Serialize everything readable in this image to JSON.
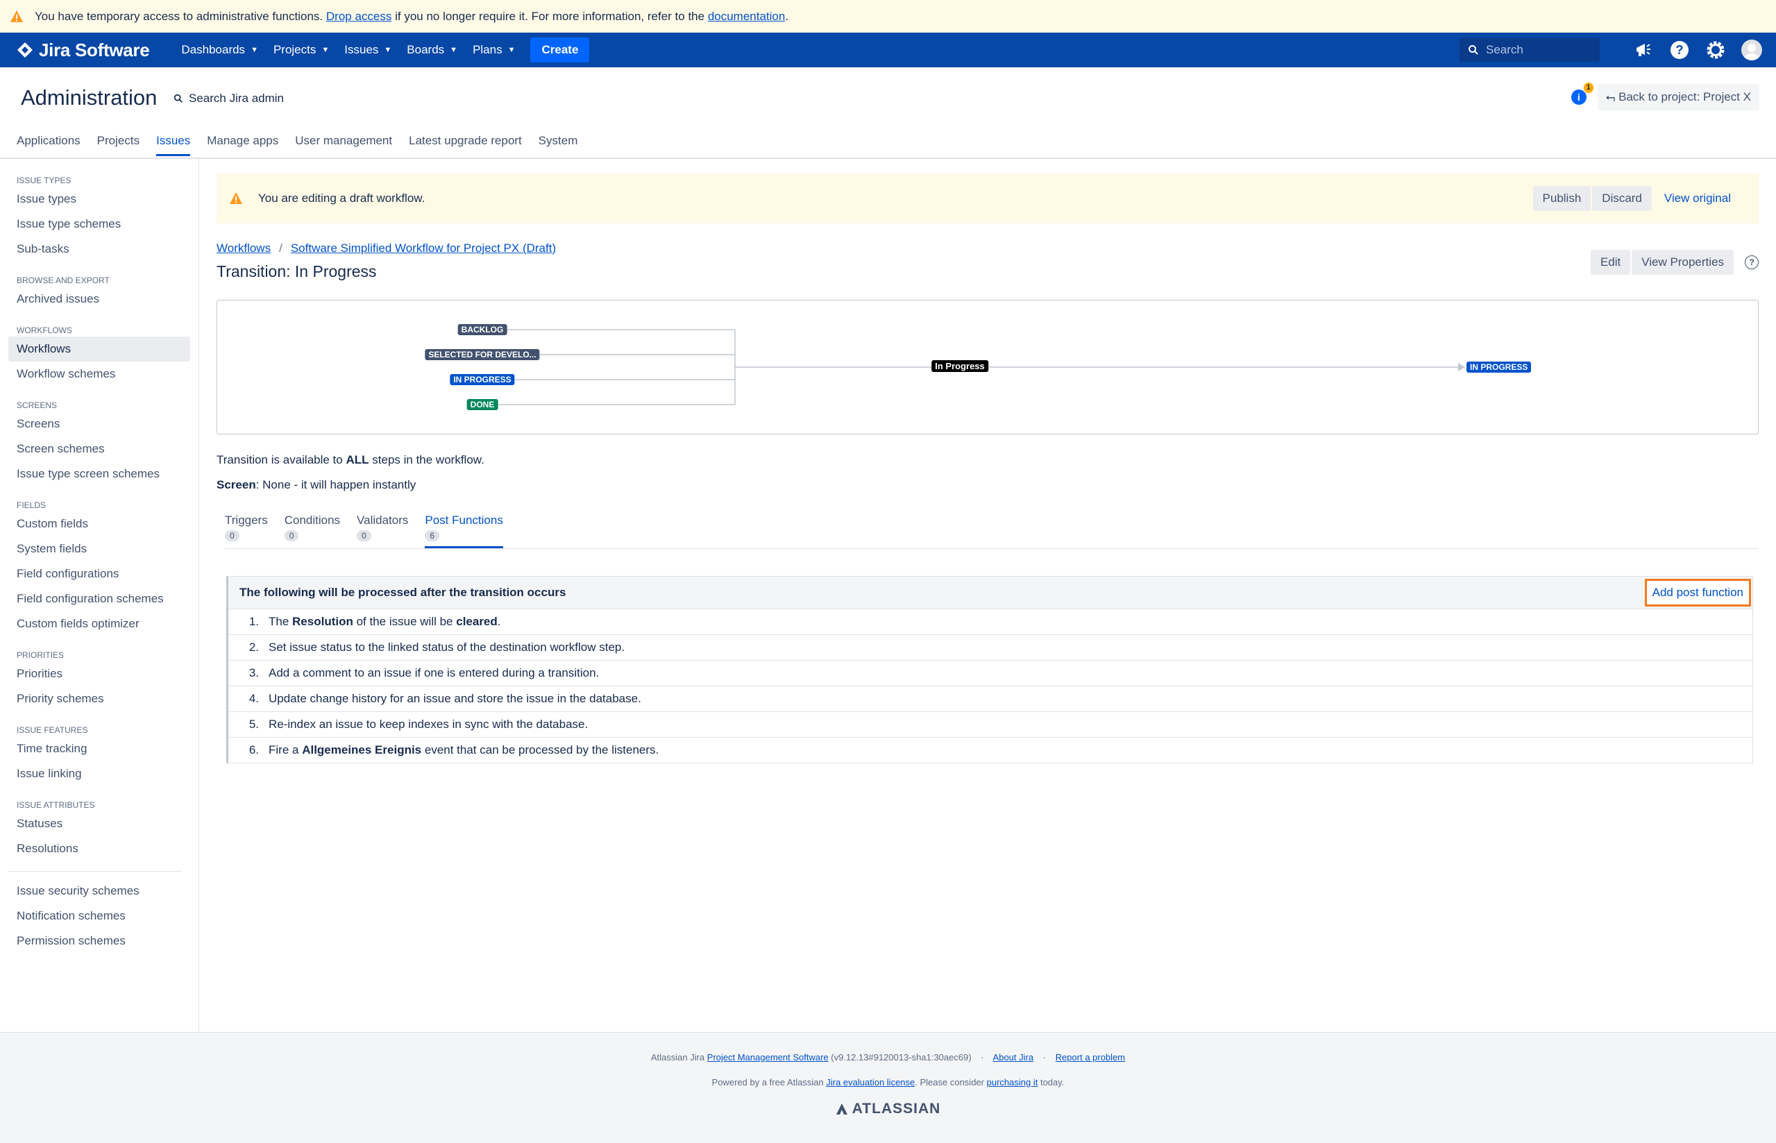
{
  "banner": {
    "text_before": "You have temporary access to administrative functions.",
    "drop_link": "Drop access",
    "text_middle": "if you no longer require it. For more information, refer to the",
    "doc_link": "documentation",
    "text_after": "."
  },
  "nav": {
    "brand": "Jira Software",
    "items": [
      "Dashboards",
      "Projects",
      "Issues",
      "Boards",
      "Plans"
    ],
    "create_label": "Create",
    "search_placeholder": "Search"
  },
  "admin": {
    "title": "Administration",
    "search_placeholder": "Search Jira admin",
    "notification_count": "1",
    "back_label": "Back to project: Project X",
    "tabs": [
      "Applications",
      "Projects",
      "Issues",
      "Manage apps",
      "User management",
      "Latest upgrade report",
      "System"
    ],
    "active_tab": "Issues"
  },
  "sidebar": {
    "groups": [
      {
        "heading": "Issue types",
        "items": [
          "Issue types",
          "Issue type schemes",
          "Sub-tasks"
        ]
      },
      {
        "heading": "Browse and export",
        "items": [
          "Archived issues"
        ]
      },
      {
        "heading": "Workflows",
        "items": [
          "Workflows",
          "Workflow schemes"
        ]
      },
      {
        "heading": "Screens",
        "items": [
          "Screens",
          "Screen schemes",
          "Issue type screen schemes"
        ]
      },
      {
        "heading": "Fields",
        "items": [
          "Custom fields",
          "System fields",
          "Field configurations",
          "Field configuration schemes",
          "Custom fields optimizer"
        ]
      },
      {
        "heading": "Priorities",
        "items": [
          "Priorities",
          "Priority schemes"
        ]
      },
      {
        "heading": "Issue features",
        "items": [
          "Time tracking",
          "Issue linking"
        ]
      },
      {
        "heading": "Issue attributes",
        "items": [
          "Statuses",
          "Resolutions"
        ]
      }
    ],
    "extra_items": [
      "Issue security schemes",
      "Notification schemes",
      "Permission schemes"
    ],
    "active_item": "Workflows"
  },
  "draft": {
    "message": "You are editing a draft workflow.",
    "publish_label": "Publish",
    "discard_label": "Discard",
    "view_original_label": "View original"
  },
  "breadcrumb": {
    "root": "Workflows",
    "current": "Software Simplified Workflow for Project PX (Draft)"
  },
  "page": {
    "title": "Transition: In Progress",
    "edit_label": "Edit",
    "view_properties_label": "View Properties"
  },
  "diagram": {
    "source_statuses": [
      {
        "name": "BACKLOG",
        "color": "#42526e"
      },
      {
        "name": "SELECTED FOR DEVELO...",
        "color": "#42526e"
      },
      {
        "name": "IN PROGRESS",
        "color": "#0052cc"
      },
      {
        "name": "DONE",
        "color": "#00875a"
      }
    ],
    "transition": "In Progress",
    "target_status": {
      "name": "IN PROGRESS",
      "color": "#0052cc"
    }
  },
  "info": {
    "availability_prefix": "Transition is available to",
    "availability_bold": "ALL",
    "availability_suffix": "steps in the workflow.",
    "screen_label": "Screen",
    "screen_value": ": None - it will happen instantly"
  },
  "tabs": [
    {
      "label": "Triggers",
      "count": "0"
    },
    {
      "label": "Conditions",
      "count": "0"
    },
    {
      "label": "Validators",
      "count": "0"
    },
    {
      "label": "Post Functions",
      "count": "6"
    }
  ],
  "active_tab": "Post Functions",
  "post_functions": {
    "header": "The following will be processed after the transition occurs",
    "add_label": "Add post function",
    "items": [
      {
        "num": "1.",
        "parts": [
          {
            "t": "The ",
            "b": false
          },
          {
            "t": "Resolution",
            "b": true
          },
          {
            "t": " of the issue will be ",
            "b": false
          },
          {
            "t": "cleared",
            "b": true
          },
          {
            "t": ".",
            "b": false
          }
        ]
      },
      {
        "num": "2.",
        "parts": [
          {
            "t": "Set issue status to the linked status of the destination workflow step.",
            "b": false
          }
        ]
      },
      {
        "num": "3.",
        "parts": [
          {
            "t": "Add a comment to an issue if one is entered during a transition.",
            "b": false
          }
        ]
      },
      {
        "num": "4.",
        "parts": [
          {
            "t": "Update change history for an issue and store the issue in the database.",
            "b": false
          }
        ]
      },
      {
        "num": "5.",
        "parts": [
          {
            "t": "Re-index an issue to keep indexes in sync with the database.",
            "b": false
          }
        ]
      },
      {
        "num": "6.",
        "parts": [
          {
            "t": "Fire a ",
            "b": false
          },
          {
            "t": "Allgemeines Ereignis",
            "b": true
          },
          {
            "t": " event that can be processed by the listeners.",
            "b": false
          }
        ]
      }
    ]
  },
  "footer": {
    "prefix": "Atlassian Jira",
    "pm_link": "Project Management Software",
    "version": "(v9.12.13#9120013-sha1:30aec69)",
    "about_link": "About Jira",
    "report_link": "Report a problem",
    "powered_prefix": "Powered by a free Atlassian",
    "eval_link": "Jira evaluation license",
    "powered_middle": ". Please consider",
    "purchase_link": "purchasing it",
    "powered_suffix": "today.",
    "brand": "ATLASSIAN"
  },
  "colors": {
    "nav_bg": "#0747a6",
    "accent": "#0052cc",
    "warning_bg": "#fffae6",
    "highlight": "#f47b20"
  }
}
